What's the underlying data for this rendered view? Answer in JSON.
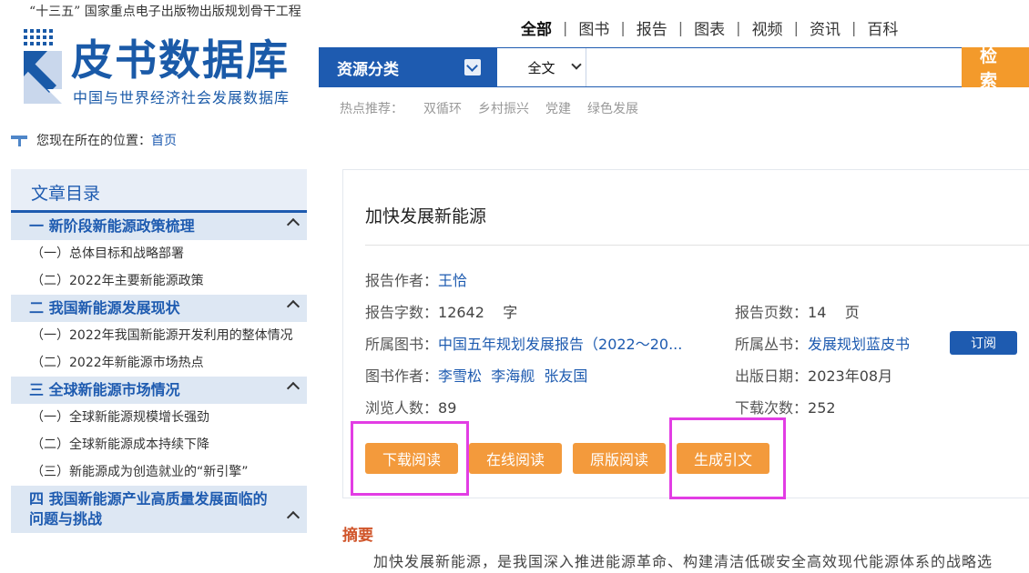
{
  "header": {
    "slogan": "“十三五” 国家重点电子出版物出版规划骨干工程",
    "logo_title": "皮书数据库",
    "logo_subtitle": "中国与世界经济社会发展数据库",
    "logo_icon": "pishu-logo-icon"
  },
  "nav": {
    "items": [
      "全部",
      "图书",
      "报告",
      "图表",
      "视频",
      "资讯",
      "百科"
    ],
    "active": "全部"
  },
  "search": {
    "category_label": "资源分类",
    "scope_value": "全文",
    "input_value": "",
    "button_label": "检 索"
  },
  "hot": {
    "label": "热点推荐：",
    "keywords": [
      "双循环",
      "乡村振兴",
      "党建",
      "绿色发展"
    ]
  },
  "location": {
    "label": "您现在所在的位置：",
    "home": "首页"
  },
  "sidebar": {
    "title": "文章目录",
    "sections": [
      {
        "title": "一  新阶段新能源政策梳理",
        "items": [
          "（一）总体目标和战略部署",
          "（二）2022年主要新能源政策"
        ]
      },
      {
        "title": "二  我国新能源发展现状",
        "items": [
          "（一）2022年我国新能源开发利用的整体情况",
          "（二）2022年新能源市场热点"
        ]
      },
      {
        "title": "三  全球新能源市场情况",
        "items": [
          "（一）全球新能源规模增长强劲",
          "（二）全球新能源成本持续下降",
          "（三）新能源成为创造就业的“新引擎”"
        ]
      },
      {
        "title": "四  我国新能源产业高质量发展面临的问题与挑战",
        "items": []
      }
    ]
  },
  "report": {
    "title": "加快发展新能源",
    "author_label": "报告作者：",
    "author": "王恰",
    "words_label": "报告字数：",
    "words": "12642",
    "words_unit": "字",
    "pages_label": "报告页数：",
    "pages": "14",
    "pages_unit": "页",
    "book_label": "所属图书：",
    "book": "中国五年规划发展报告（2022～20...",
    "series_label": "所属丛书：",
    "series": "发展规划蓝皮书",
    "subscribe_label": "订阅",
    "book_authors_label": "图书作者：",
    "book_authors": [
      "李雪松",
      "李海舰",
      "张友国"
    ],
    "pub_date_label": "出版日期：",
    "pub_date": "2023年08月",
    "views_label": "浏览人数：",
    "views": "89",
    "downloads_label": "下载次数：",
    "downloads": "252",
    "buttons": [
      "下载阅读",
      "在线阅读",
      "原版阅读",
      "生成引文"
    ]
  },
  "abstract": {
    "title": "摘要",
    "text": "加快发展新能源，是我国深入推进能源革命、构建清洁低碳安全高效现代能源体系的战略选"
  },
  "colors": {
    "brand_blue": "#1e5bb0",
    "accent_orange": "#f39a3c",
    "highlight_magenta": "#e23de4",
    "abstract_red": "#d0552a"
  }
}
